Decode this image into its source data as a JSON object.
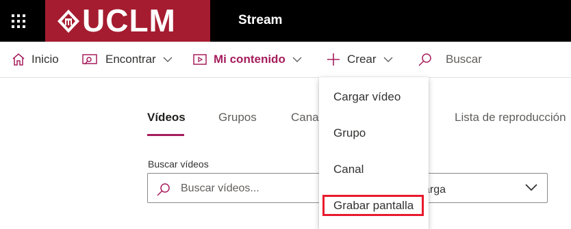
{
  "header": {
    "logo_text": "UCLM",
    "app_title": "Stream"
  },
  "nav": {
    "home": "Inicio",
    "discover": "Encontrar",
    "my_content": "Mi contenido",
    "create": "Crear",
    "search": "Buscar"
  },
  "tabs": {
    "videos": "Vídeos",
    "groups": "Grupos",
    "channels": "Canal",
    "playlists": "Lista de reproducción"
  },
  "search": {
    "label": "Buscar vídeos",
    "placeholder": "Buscar vídeos..."
  },
  "sort": {
    "value_fragment": "arga"
  },
  "create_menu": {
    "items": [
      "Cargar vídeo",
      "Grupo",
      "Canal",
      "Grabar pantalla"
    ],
    "highlighted_item": "Grabar pantalla"
  },
  "colors": {
    "accent": "#a51c5c",
    "brand": "#a51c30",
    "highlight_border": "#e8192c"
  }
}
